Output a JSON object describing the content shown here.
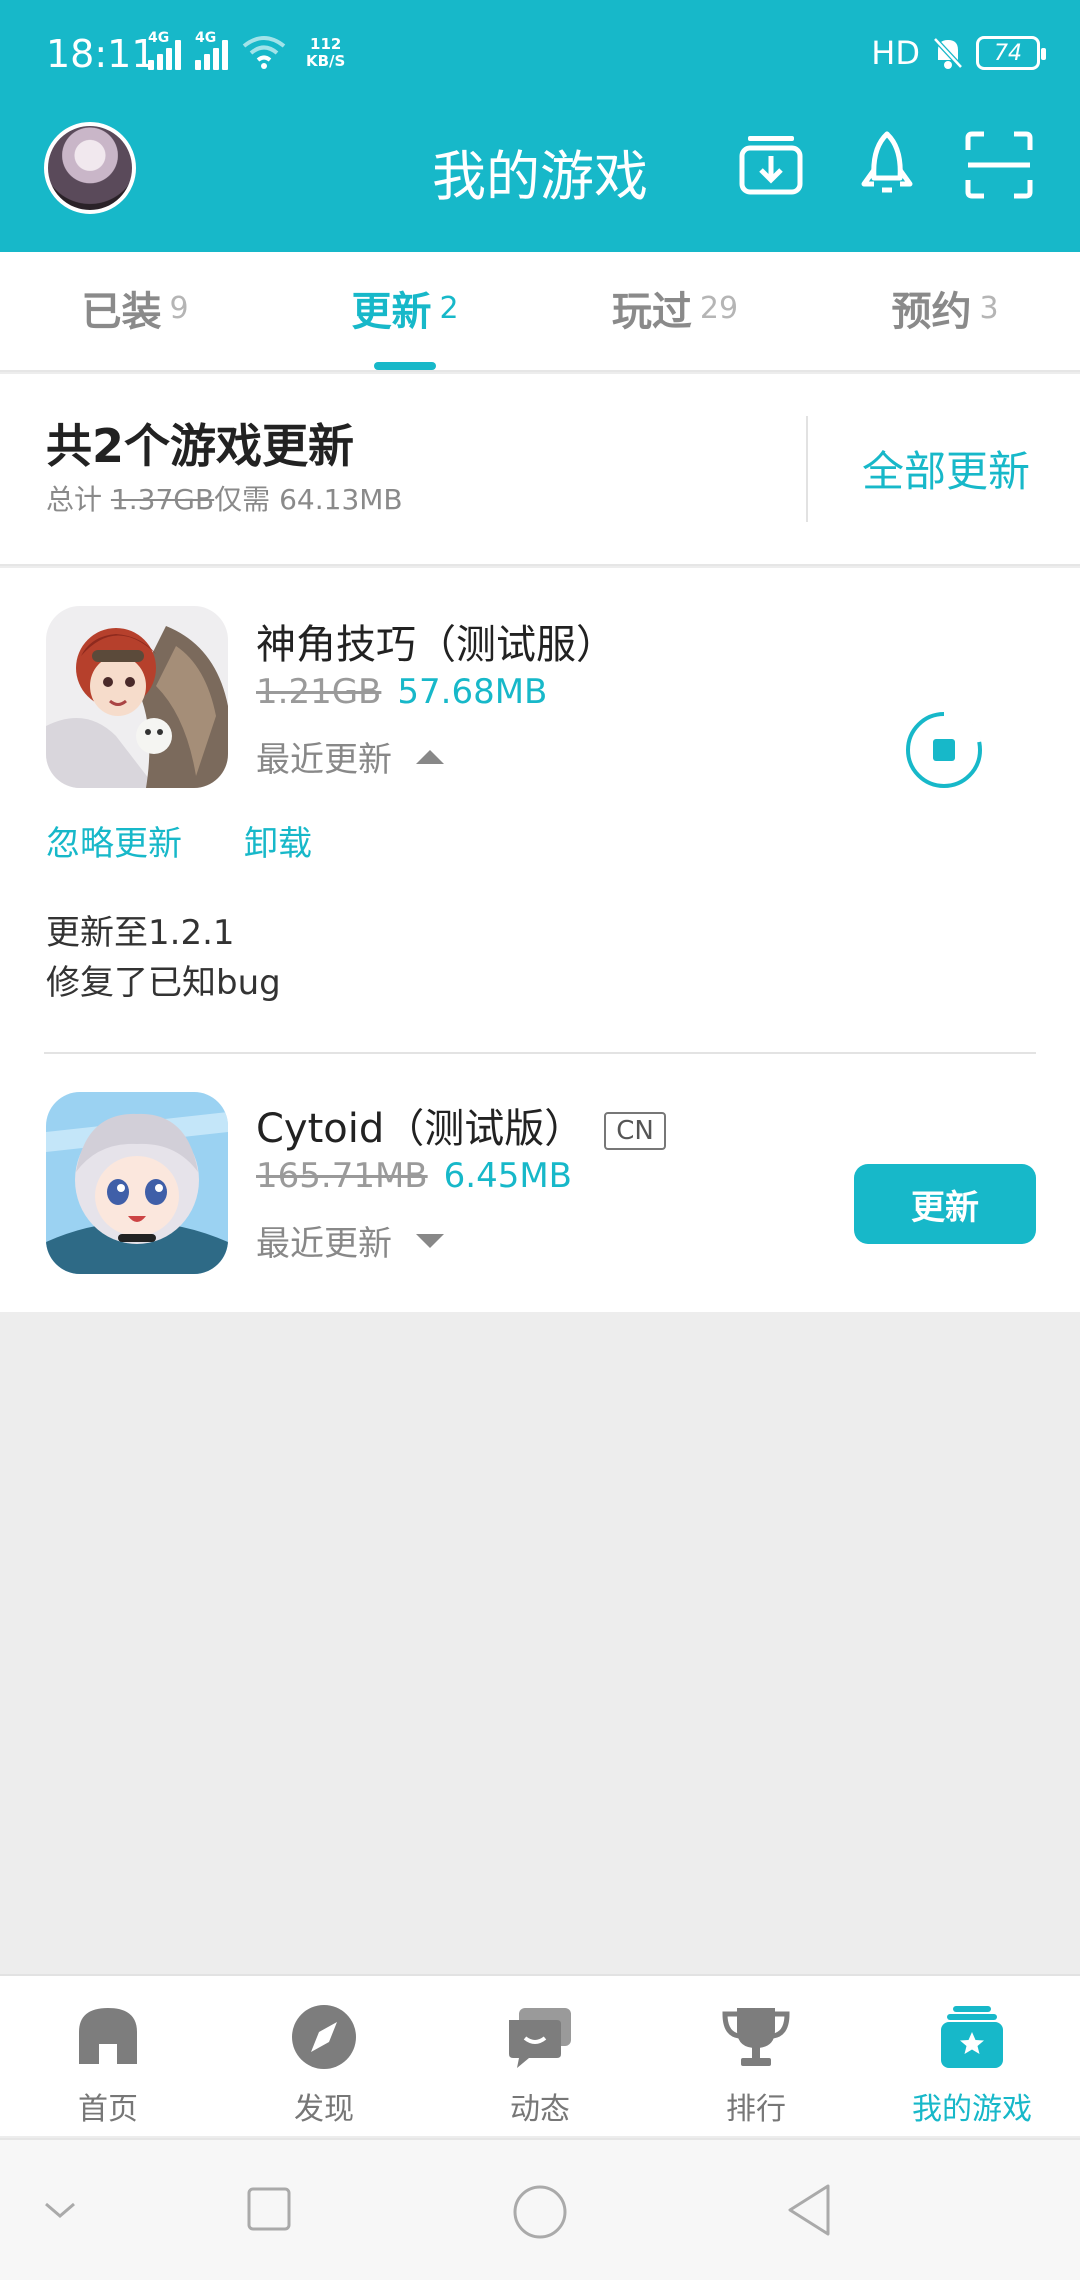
{
  "status_bar": {
    "time": "18:11",
    "signal_1": "4G",
    "signal_2": "4G",
    "speed_value": "112",
    "speed_unit": "KB/S",
    "hd": "HD",
    "battery": "74"
  },
  "header": {
    "title": "我的游戏",
    "icons": [
      "download-manager-icon",
      "rocket-icon",
      "scan-icon"
    ]
  },
  "tabs": [
    {
      "label": "已装",
      "count": "9"
    },
    {
      "label": "更新",
      "count": "2",
      "active": true
    },
    {
      "label": "玩过",
      "count": "29"
    },
    {
      "label": "预约",
      "count": "3"
    }
  ],
  "summary": {
    "title": "共2个游戏更新",
    "total_prefix": "总计",
    "total_old": "1.37GB",
    "total_mid": "仅需",
    "total_new": "64.13MB",
    "update_all": "全部更新"
  },
  "games": [
    {
      "name": "神角技巧（测试服）",
      "old_size": "1.21GB",
      "new_size": "57.68MB",
      "recent_label": "最近更新",
      "expanded": true,
      "actions": [
        "忽略更新",
        "卸载"
      ],
      "changelog": [
        "更新至1.2.1",
        "修复了已知bug"
      ],
      "status": "downloading"
    },
    {
      "name": "Cytoid（测试版）",
      "tag": "CN",
      "old_size": "165.71MB",
      "new_size": "6.45MB",
      "recent_label": "最近更新",
      "expanded": false,
      "button": "更新"
    }
  ],
  "bottom_nav": [
    {
      "label": "首页",
      "icon": "home-icon"
    },
    {
      "label": "发现",
      "icon": "compass-icon"
    },
    {
      "label": "动态",
      "icon": "chat-icon"
    },
    {
      "label": "排行",
      "icon": "trophy-icon"
    },
    {
      "label": "我的游戏",
      "icon": "my-games-icon",
      "active": true
    }
  ],
  "colors": {
    "accent": "#17b8c9",
    "background": "#ededed",
    "muted": "#8a8a8a"
  }
}
